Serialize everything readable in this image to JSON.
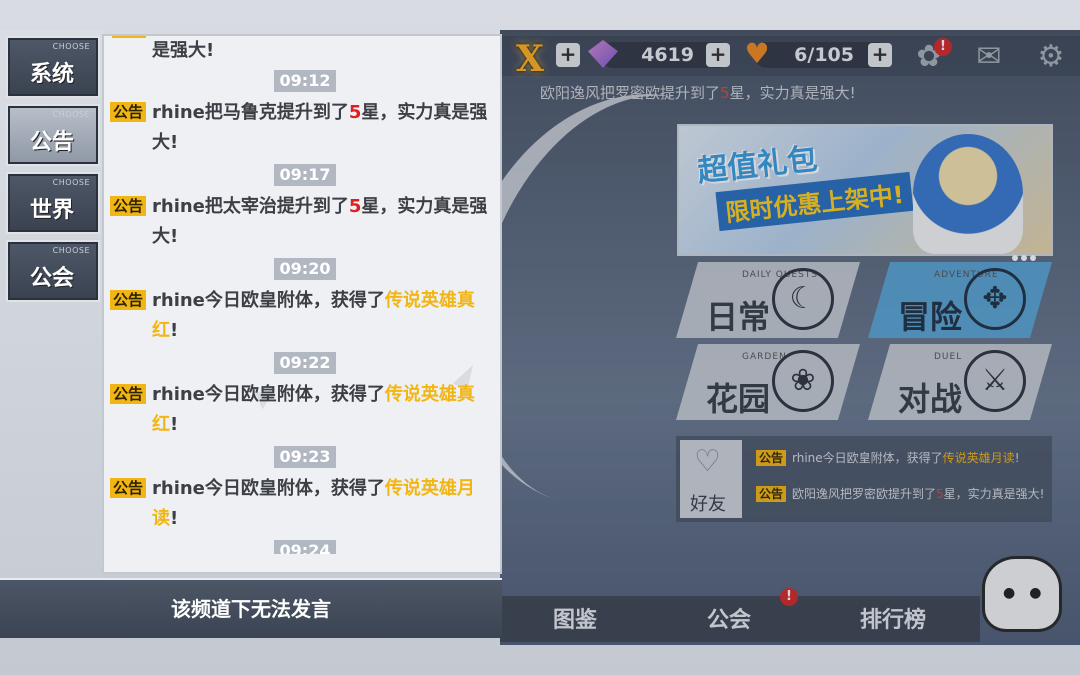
{
  "top_bar": {
    "close_symbol": "X",
    "gems": "4619",
    "stamina": "6/105",
    "plus": "+",
    "badge": "!"
  },
  "marquee": {
    "prefix": "欧阳逸风把罗密欧提升到了",
    "star": "5",
    "suffix": "星，实力真是强大!"
  },
  "banner": {
    "title": "超值礼包",
    "subtitle": "限时优惠上架中!"
  },
  "modes": [
    {
      "en": "DAILY QUESTS",
      "zh": "日常",
      "icon": "moon-emblem-icon"
    },
    {
      "en": "ADVENTURE",
      "zh": "冒险",
      "icon": "compass-emblem-icon"
    },
    {
      "en": "GARDEN",
      "zh": "花园",
      "icon": "flower-emblem-icon"
    },
    {
      "en": "DUEL",
      "zh": "对战",
      "icon": "crossed-swords-emblem-icon"
    }
  ],
  "friend": {
    "label": "好友",
    "messages": [
      {
        "tag": "公告",
        "a": "rhine今日欧皇附体，获得了",
        "b": "传说英雄月读",
        "c": "!"
      },
      {
        "tag": "公告",
        "a": "欧阳逸风把罗密欧提升到了",
        "b": "5",
        "c": "星，实力真是强大!"
      }
    ]
  },
  "bottom_nav": [
    "图鉴",
    "公会",
    "排行榜"
  ],
  "tabs": [
    {
      "choose": "CHOOSE",
      "label": "系统",
      "active": false
    },
    {
      "choose": "CHOOSE",
      "label": "公告",
      "active": true
    },
    {
      "choose": "CHOOSE",
      "label": "世界",
      "active": false
    },
    {
      "choose": "CHOOSE",
      "label": "公会",
      "active": false
    }
  ],
  "chat": {
    "cut_line": "是强大!",
    "messages": [
      {
        "time": "09:12",
        "tag": "公告",
        "pre": "rhine把马鲁克提升到了",
        "hl": "5",
        "hl_color": "red",
        "post": "星，实力真是强大!"
      },
      {
        "time": "09:17",
        "tag": "公告",
        "pre": "rhine把太宰治提升到了",
        "hl": "5",
        "hl_color": "red",
        "post": "星，实力真是强大!"
      },
      {
        "time": "09:20",
        "tag": "公告",
        "pre": "rhine今日欧皇附体，获得了",
        "hl": "传说英雄真红",
        "hl_color": "gold",
        "post": "!"
      },
      {
        "time": "09:22",
        "tag": "公告",
        "pre": "rhine今日欧皇附体，获得了",
        "hl": "传说英雄真红",
        "hl_color": "gold",
        "post": "!"
      },
      {
        "time": "09:23",
        "tag": "公告",
        "pre": "rhine今日欧皇附体，获得了",
        "hl": "传说英雄月读",
        "hl_color": "gold",
        "post": "!"
      }
    ],
    "last_time": "09:24",
    "footer_notice": "该频道下无法发言"
  }
}
